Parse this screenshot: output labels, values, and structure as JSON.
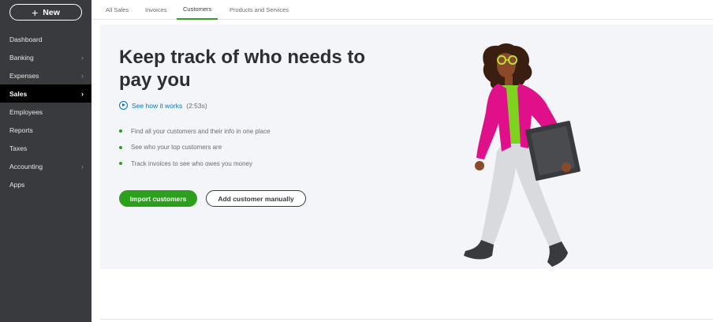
{
  "sidebar": {
    "new_label": "New",
    "items": [
      {
        "label": "Dashboard",
        "chevron": false,
        "active": false
      },
      {
        "label": "Banking",
        "chevron": true,
        "active": false
      },
      {
        "label": "Expenses",
        "chevron": true,
        "active": false
      },
      {
        "label": "Sales",
        "chevron": true,
        "active": true
      },
      {
        "label": "Employees",
        "chevron": false,
        "active": false
      },
      {
        "label": "Reports",
        "chevron": false,
        "active": false
      },
      {
        "label": "Taxes",
        "chevron": false,
        "active": false
      },
      {
        "label": "Accounting",
        "chevron": true,
        "active": false
      },
      {
        "label": "Apps",
        "chevron": false,
        "active": false
      }
    ]
  },
  "tabs": [
    {
      "label": "All Sales",
      "active": false
    },
    {
      "label": "Invoices",
      "active": false
    },
    {
      "label": "Customers",
      "active": true
    },
    {
      "label": "Products and Services",
      "active": false
    }
  ],
  "main": {
    "headline": "Keep track of who needs to pay you",
    "video_link": "See how it works",
    "video_duration": "(2:53s)",
    "bullets": [
      "Find all your customers and their info in one place",
      "See who your top customers are",
      "Track invoices to see who owes you money"
    ],
    "primary_button": "Import customers",
    "secondary_button": "Add customer manually"
  },
  "colors": {
    "sidebar_bg": "#393a3d",
    "accent_green": "#2ca01c",
    "link_blue": "#0077c5",
    "panel_bg": "#f4f5f8"
  },
  "icons": [
    "plus-icon",
    "chevron-right-icon",
    "play-circle-icon"
  ]
}
